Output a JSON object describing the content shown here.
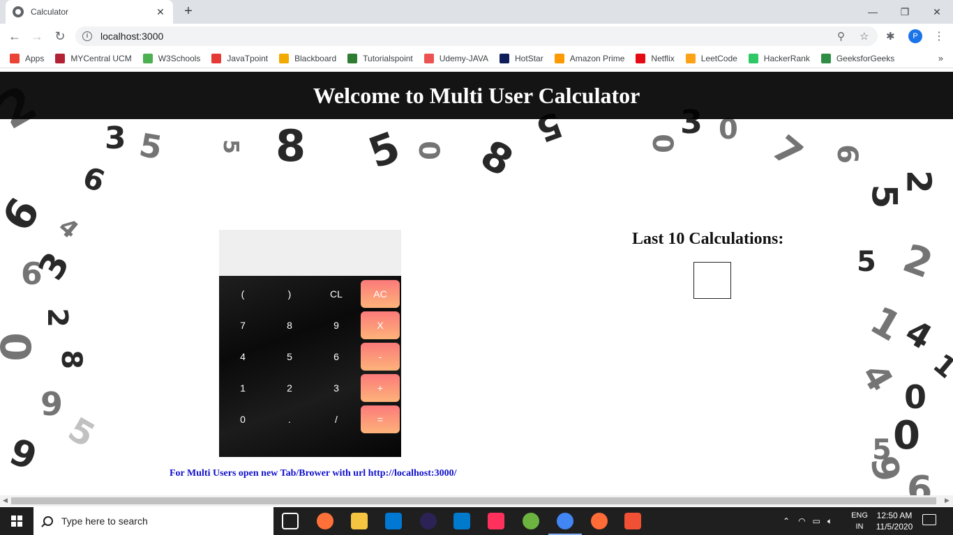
{
  "browser": {
    "tab_title": "Calculator",
    "tab_close": "✕",
    "new_tab": "+",
    "url": "localhost:3000",
    "profile_initial": "P",
    "window_controls": [
      "—",
      "❐",
      "✕"
    ],
    "bookmarks": [
      {
        "label": "Apps",
        "icon": "apps-grid-icon",
        "color": "#ea4335"
      },
      {
        "label": "MYCentral UCM",
        "icon": "mule-icon",
        "color": "#b22234"
      },
      {
        "label": "W3Schools",
        "icon": "w3schools-icon",
        "color": "#4caf50"
      },
      {
        "label": "JavaTpoint",
        "icon": "javatpoint-icon",
        "color": "#e53935"
      },
      {
        "label": "Blackboard",
        "icon": "blackboard-icon",
        "color": "#f2a900"
      },
      {
        "label": "Tutorialspoint",
        "icon": "tutorialspoint-icon",
        "color": "#2e7d32"
      },
      {
        "label": "Udemy-JAVA",
        "icon": "udemy-icon",
        "color": "#ec5252"
      },
      {
        "label": "HotStar",
        "icon": "hotstar-icon",
        "color": "#0f1e5a"
      },
      {
        "label": "Amazon Prime",
        "icon": "amazon-icon",
        "color": "#ff9900"
      },
      {
        "label": "Netflix",
        "icon": "netflix-icon",
        "color": "#e50914"
      },
      {
        "label": "LeetCode",
        "icon": "leetcode-icon",
        "color": "#ffa116"
      },
      {
        "label": "HackerRank",
        "icon": "hackerrank-icon",
        "color": "#2ec866"
      },
      {
        "label": "GeeksforGeeks",
        "icon": "geeksforgeeks-icon",
        "color": "#2f8d46"
      }
    ],
    "bookmarks_more": "»"
  },
  "page": {
    "header_title": "Welcome to Multi User Calculator",
    "calculator": {
      "display_value": "",
      "rows": [
        [
          {
            "label": "(",
            "op": false
          },
          {
            "label": ")",
            "op": false
          },
          {
            "label": "CL",
            "op": false
          },
          {
            "label": "AC",
            "op": true
          }
        ],
        [
          {
            "label": "7",
            "op": false
          },
          {
            "label": "8",
            "op": false
          },
          {
            "label": "9",
            "op": false
          },
          {
            "label": "X",
            "op": true
          }
        ],
        [
          {
            "label": "4",
            "op": false
          },
          {
            "label": "5",
            "op": false
          },
          {
            "label": "6",
            "op": false
          },
          {
            "label": "-",
            "op": true
          }
        ],
        [
          {
            "label": "1",
            "op": false
          },
          {
            "label": "2",
            "op": false
          },
          {
            "label": "3",
            "op": false
          },
          {
            "label": "+",
            "op": true
          }
        ],
        [
          {
            "label": "0",
            "op": false
          },
          {
            "label": ".",
            "op": false
          },
          {
            "label": "/",
            "op": false
          },
          {
            "label": "=",
            "op": true
          }
        ]
      ]
    },
    "multi_user_note": "For Multi Users open new Tab/Brower with url http://localhost:3000/",
    "history_title": "Last 10 Calculations:",
    "history_items": []
  },
  "taskbar": {
    "search_placeholder": "Type here to search",
    "language_line1": "ENG",
    "language_line2": "IN",
    "time": "12:50 AM",
    "date": "11/5/2020",
    "apps": [
      {
        "name": "task-view-icon",
        "color": "#1f1f1f"
      },
      {
        "name": "firefox-icon",
        "color": "#ff7139"
      },
      {
        "name": "file-explorer-icon",
        "color": "#f5c542"
      },
      {
        "name": "mail-icon",
        "color": "#0078d4"
      },
      {
        "name": "eclipse-icon",
        "color": "#2c2255"
      },
      {
        "name": "vscode-icon",
        "color": "#007acc"
      },
      {
        "name": "intellij-icon",
        "color": "#fe315d"
      },
      {
        "name": "spring-icon",
        "color": "#6db33f"
      },
      {
        "name": "chrome-icon",
        "color": "#4285f4"
      },
      {
        "name": "postman-icon",
        "color": "#ff6c37"
      },
      {
        "name": "git-icon",
        "color": "#f05033"
      }
    ]
  },
  "colors": {
    "accent_blue": "#1a73e8",
    "op_key_top": "#fb7a7a",
    "op_key_bottom": "#fdb37a",
    "note_blue": "#1010cc"
  }
}
